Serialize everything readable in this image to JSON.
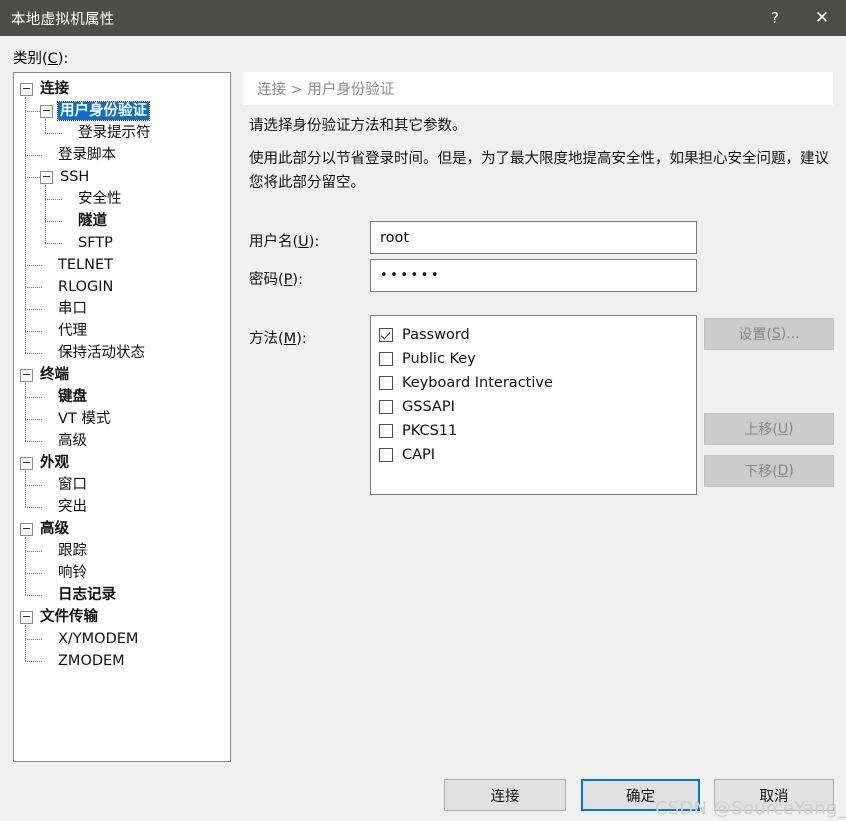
{
  "window": {
    "title": "本地虚拟机属性",
    "help_icon": "question-mark-icon",
    "close_icon": "close-x-icon",
    "titlebar_color": "#4d4d4b"
  },
  "category": {
    "label_pre": "类别(",
    "label_key": "C",
    "label_post": "):"
  },
  "tree": {
    "selected": "用户身份验证",
    "nodes": [
      {
        "label": "连接",
        "level": 0,
        "bold": true,
        "expandable": true,
        "selected": false
      },
      {
        "label": "用户身份验证",
        "level": 1,
        "bold": true,
        "expandable": true,
        "selected": true
      },
      {
        "label": "登录提示符",
        "level": 2,
        "bold": false,
        "expandable": false,
        "selected": false
      },
      {
        "label": "登录脚本",
        "level": 1,
        "bold": false,
        "expandable": false,
        "selected": false
      },
      {
        "label": "SSH",
        "level": 1,
        "bold": false,
        "expandable": true,
        "selected": false
      },
      {
        "label": "安全性",
        "level": 2,
        "bold": false,
        "expandable": false,
        "selected": false
      },
      {
        "label": "隧道",
        "level": 2,
        "bold": true,
        "expandable": false,
        "selected": false
      },
      {
        "label": "SFTP",
        "level": 2,
        "bold": false,
        "expandable": false,
        "selected": false
      },
      {
        "label": "TELNET",
        "level": 1,
        "bold": false,
        "expandable": false,
        "selected": false
      },
      {
        "label": "RLOGIN",
        "level": 1,
        "bold": false,
        "expandable": false,
        "selected": false
      },
      {
        "label": "串口",
        "level": 1,
        "bold": false,
        "expandable": false,
        "selected": false
      },
      {
        "label": "代理",
        "level": 1,
        "bold": false,
        "expandable": false,
        "selected": false
      },
      {
        "label": "保持活动状态",
        "level": 1,
        "bold": false,
        "expandable": false,
        "selected": false
      },
      {
        "label": "终端",
        "level": 0,
        "bold": true,
        "expandable": true,
        "selected": false
      },
      {
        "label": "键盘",
        "level": 1,
        "bold": true,
        "expandable": false,
        "selected": false
      },
      {
        "label": "VT 模式",
        "level": 1,
        "bold": false,
        "expandable": false,
        "selected": false
      },
      {
        "label": "高级",
        "level": 1,
        "bold": false,
        "expandable": false,
        "selected": false
      },
      {
        "label": "外观",
        "level": 0,
        "bold": true,
        "expandable": true,
        "selected": false
      },
      {
        "label": "窗口",
        "level": 1,
        "bold": false,
        "expandable": false,
        "selected": false
      },
      {
        "label": "突出",
        "level": 1,
        "bold": false,
        "expandable": false,
        "selected": false
      },
      {
        "label": "高级",
        "level": 0,
        "bold": true,
        "expandable": true,
        "selected": false
      },
      {
        "label": "跟踪",
        "level": 1,
        "bold": false,
        "expandable": false,
        "selected": false
      },
      {
        "label": "响铃",
        "level": 1,
        "bold": false,
        "expandable": false,
        "selected": false
      },
      {
        "label": "日志记录",
        "level": 1,
        "bold": true,
        "expandable": false,
        "selected": false
      },
      {
        "label": "文件传输",
        "level": 0,
        "bold": true,
        "expandable": true,
        "selected": false
      },
      {
        "label": "X/YMODEM",
        "level": 1,
        "bold": false,
        "expandable": false,
        "selected": false
      },
      {
        "label": "ZMODEM",
        "level": 1,
        "bold": false,
        "expandable": false,
        "selected": false
      }
    ]
  },
  "content": {
    "breadcrumb": "连接 > 用户身份验证",
    "description_1": "请选择身份验证方法和其它参数。",
    "description_2": "使用此部分以节省登录时间。但是，为了最大限度地提高安全性，如果担心安全问题，建议您将此部分留空。",
    "username": {
      "label_pre": "用户名(",
      "label_key": "U",
      "label_post": "):",
      "value": "root"
    },
    "password": {
      "label_pre": "密码(",
      "label_key": "P",
      "label_post": "):",
      "value": "••••••",
      "masked_length": 6
    },
    "method": {
      "label_pre": "方法(",
      "label_key": "M",
      "label_post": "):",
      "items": [
        {
          "label": "Password",
          "checked": true
        },
        {
          "label": "Public Key",
          "checked": false
        },
        {
          "label": "Keyboard Interactive",
          "checked": false
        },
        {
          "label": "GSSAPI",
          "checked": false
        },
        {
          "label": "PKCS11",
          "checked": false
        },
        {
          "label": "CAPI",
          "checked": false
        }
      ]
    },
    "side_buttons": [
      {
        "label_pre": "设置(",
        "label_key": "S",
        "label_post": ")...",
        "enabled": false
      },
      {
        "label_pre": "上移(",
        "label_key": "U",
        "label_post": ")",
        "enabled": false
      },
      {
        "label_pre": "下移(",
        "label_key": "D",
        "label_post": ")",
        "enabled": false
      }
    ]
  },
  "footer": {
    "connect": "连接",
    "ok": "确定",
    "cancel": "取消",
    "focused": "确定"
  },
  "watermark": {
    "text": "CSDN @SourceYang_A",
    "color": "#cfcfcf"
  }
}
